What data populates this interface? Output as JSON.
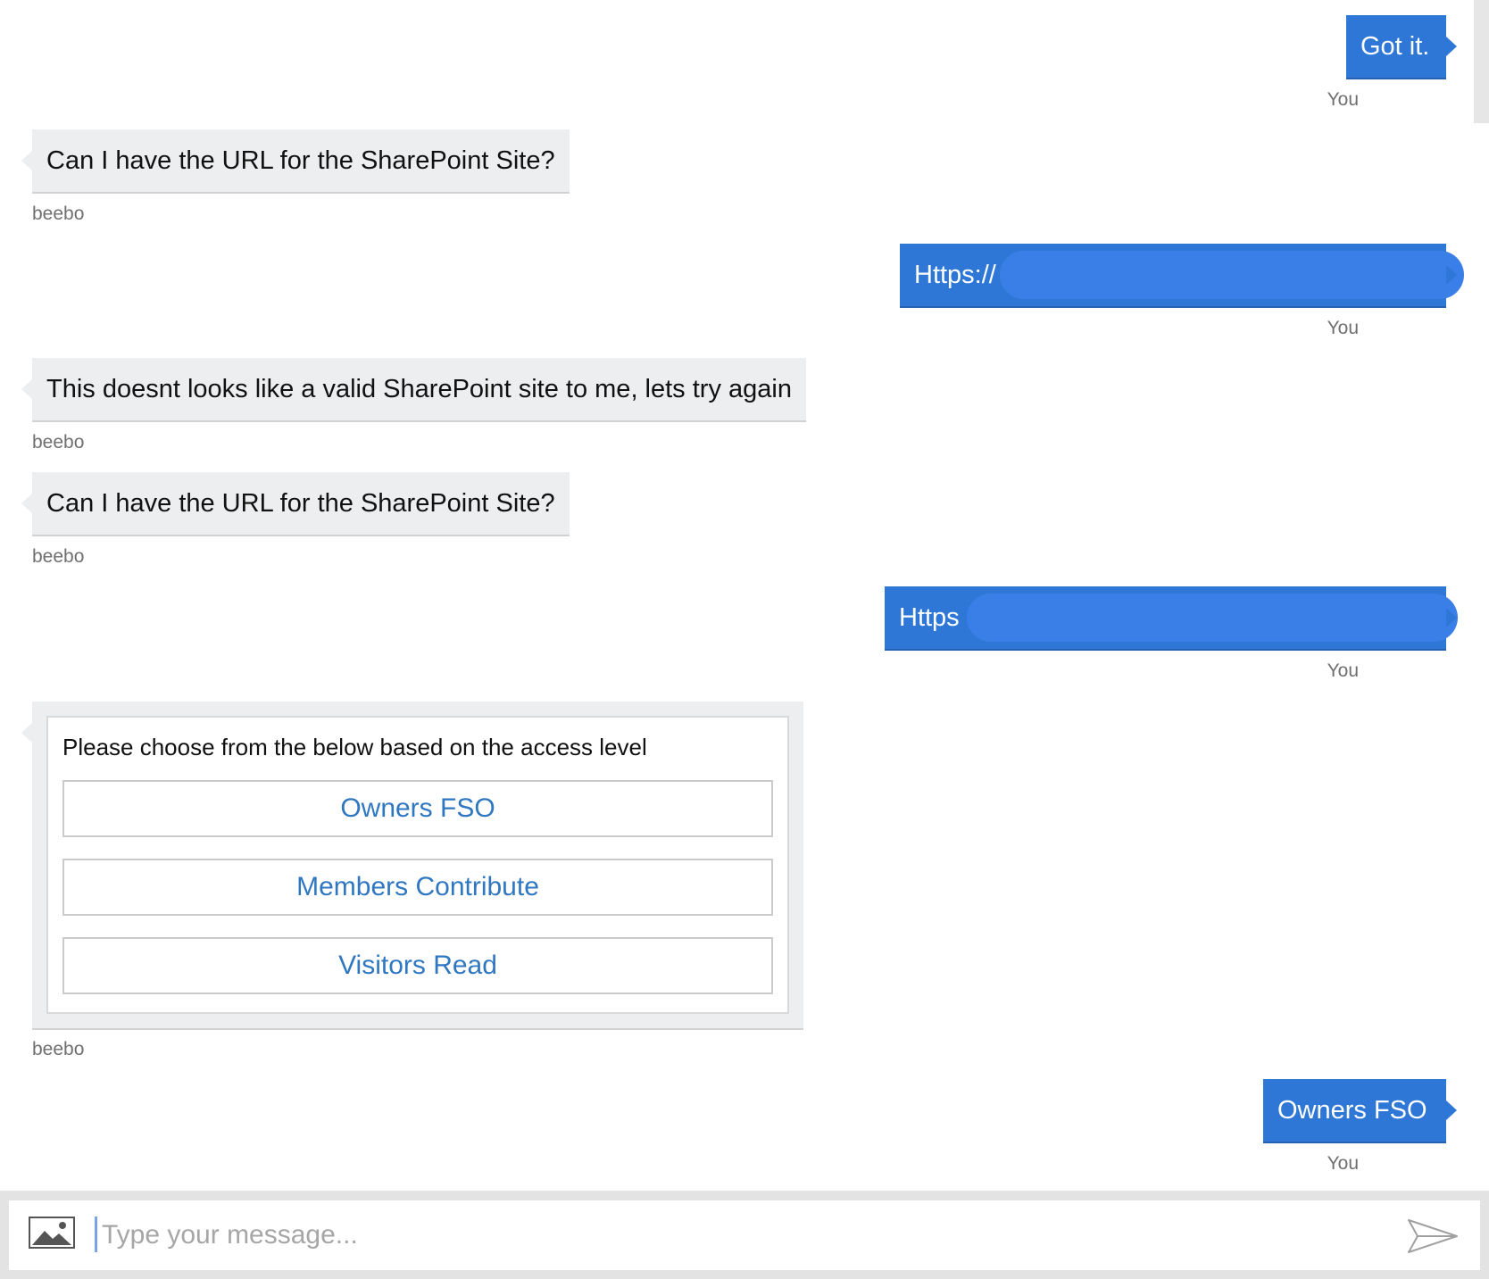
{
  "messages": [
    {
      "from": "user",
      "text": "Got it.",
      "sender": "You"
    },
    {
      "from": "bot",
      "text": "Can I have the URL for the SharePoint Site?",
      "sender": "beebo"
    },
    {
      "from": "user",
      "text": "Https://",
      "sender": "You",
      "redacted": true
    },
    {
      "from": "bot",
      "text": "This doesnt looks like a valid SharePoint site to me, lets try again",
      "sender": "beebo"
    },
    {
      "from": "bot",
      "text": "Can I have the URL for the SharePoint Site?",
      "sender": "beebo"
    },
    {
      "from": "user",
      "text": "Https",
      "sender": "You",
      "redacted": true
    },
    {
      "from": "bot",
      "type": "card",
      "sender": "beebo",
      "card": {
        "text": "Please choose from the below based on the access level",
        "choices": [
          "Owners FSO",
          "Members Contribute",
          "Visitors Read"
        ]
      }
    },
    {
      "from": "user",
      "text": "Owners FSO",
      "sender": "You"
    }
  ],
  "composer": {
    "placeholder": "Type your message...",
    "value": "",
    "attach_icon": "image-icon",
    "send_icon": "send-icon"
  },
  "colors": {
    "user_bubble": "#2f77d6",
    "bot_bubble": "#eceef0",
    "choice_text": "#2f77c0",
    "redaction": "#3a7fe8"
  }
}
